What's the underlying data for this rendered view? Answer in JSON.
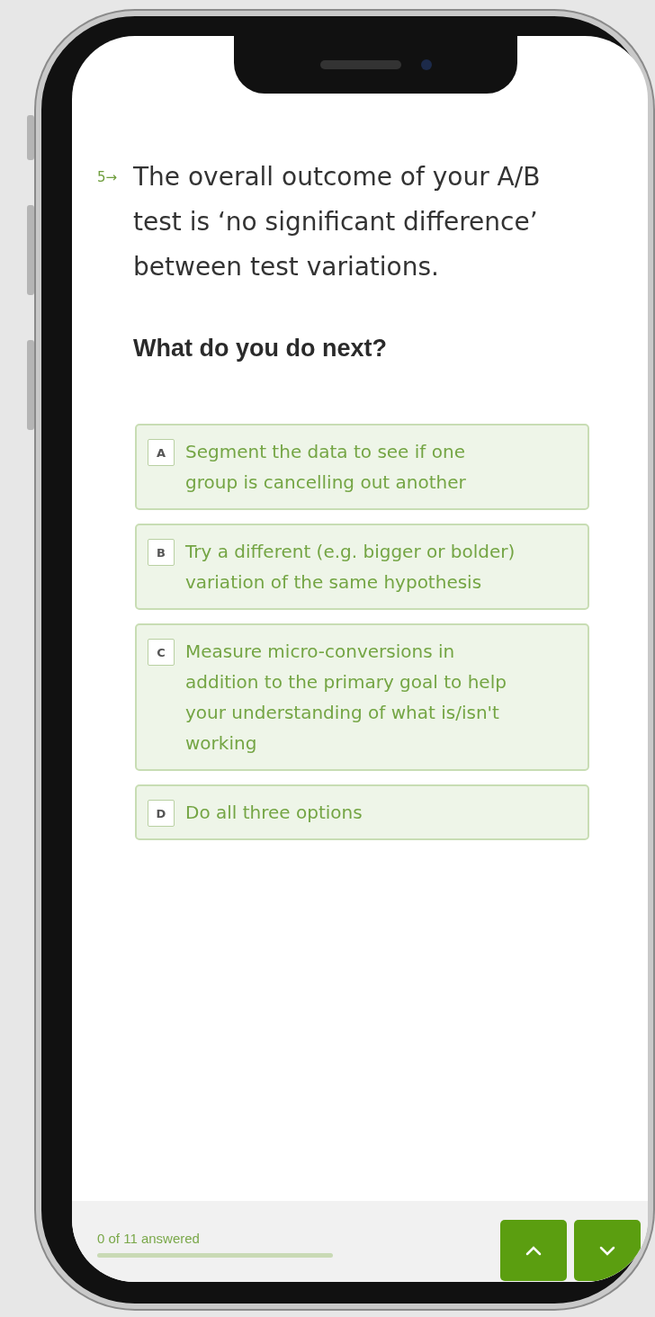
{
  "question": {
    "number": "5→",
    "text": "The overall outcome of your A/B test is ‘no significant difference’ between test variations.",
    "prompt": "What do you do next?"
  },
  "options": [
    {
      "key": "A",
      "text": "Segment the data to see if one group is cancelling out another",
      "selected": false
    },
    {
      "key": "B",
      "text": "Try a different (e.g. bigger or bolder) variation of the same hypothesis",
      "selected": false
    },
    {
      "key": "C",
      "text": "Measure micro-conversions in addition to the primary goal to help your understanding of what is/isn't working",
      "selected": false
    },
    {
      "key": "D",
      "text": "Do all three options",
      "selected": false
    }
  ],
  "footer": {
    "progress_label": "0 of 11 answered",
    "level": 0
  }
}
